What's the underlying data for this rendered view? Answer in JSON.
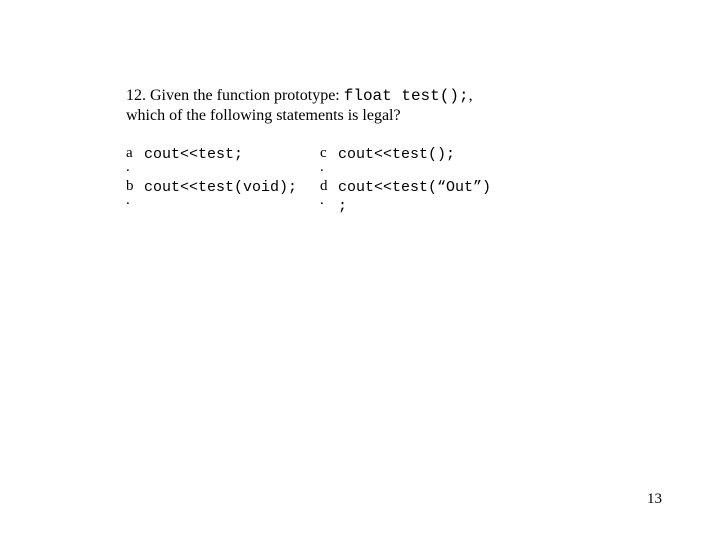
{
  "question": {
    "number": "12.",
    "line1_a": "Given the function prototype: ",
    "line1_code": "float test();",
    "line1_b": ",",
    "line2": "which of the following statements is legal?"
  },
  "options": {
    "a": {
      "label": "a",
      "code": "cout<<test;"
    },
    "b": {
      "label": "b",
      "code": "cout<<test(void);"
    },
    "c": {
      "label": "c",
      "code": "cout<<test();"
    },
    "d": {
      "label": "d",
      "code": "cout<<test(“Out”)\n;"
    }
  },
  "dot": ".",
  "page_number": "13"
}
